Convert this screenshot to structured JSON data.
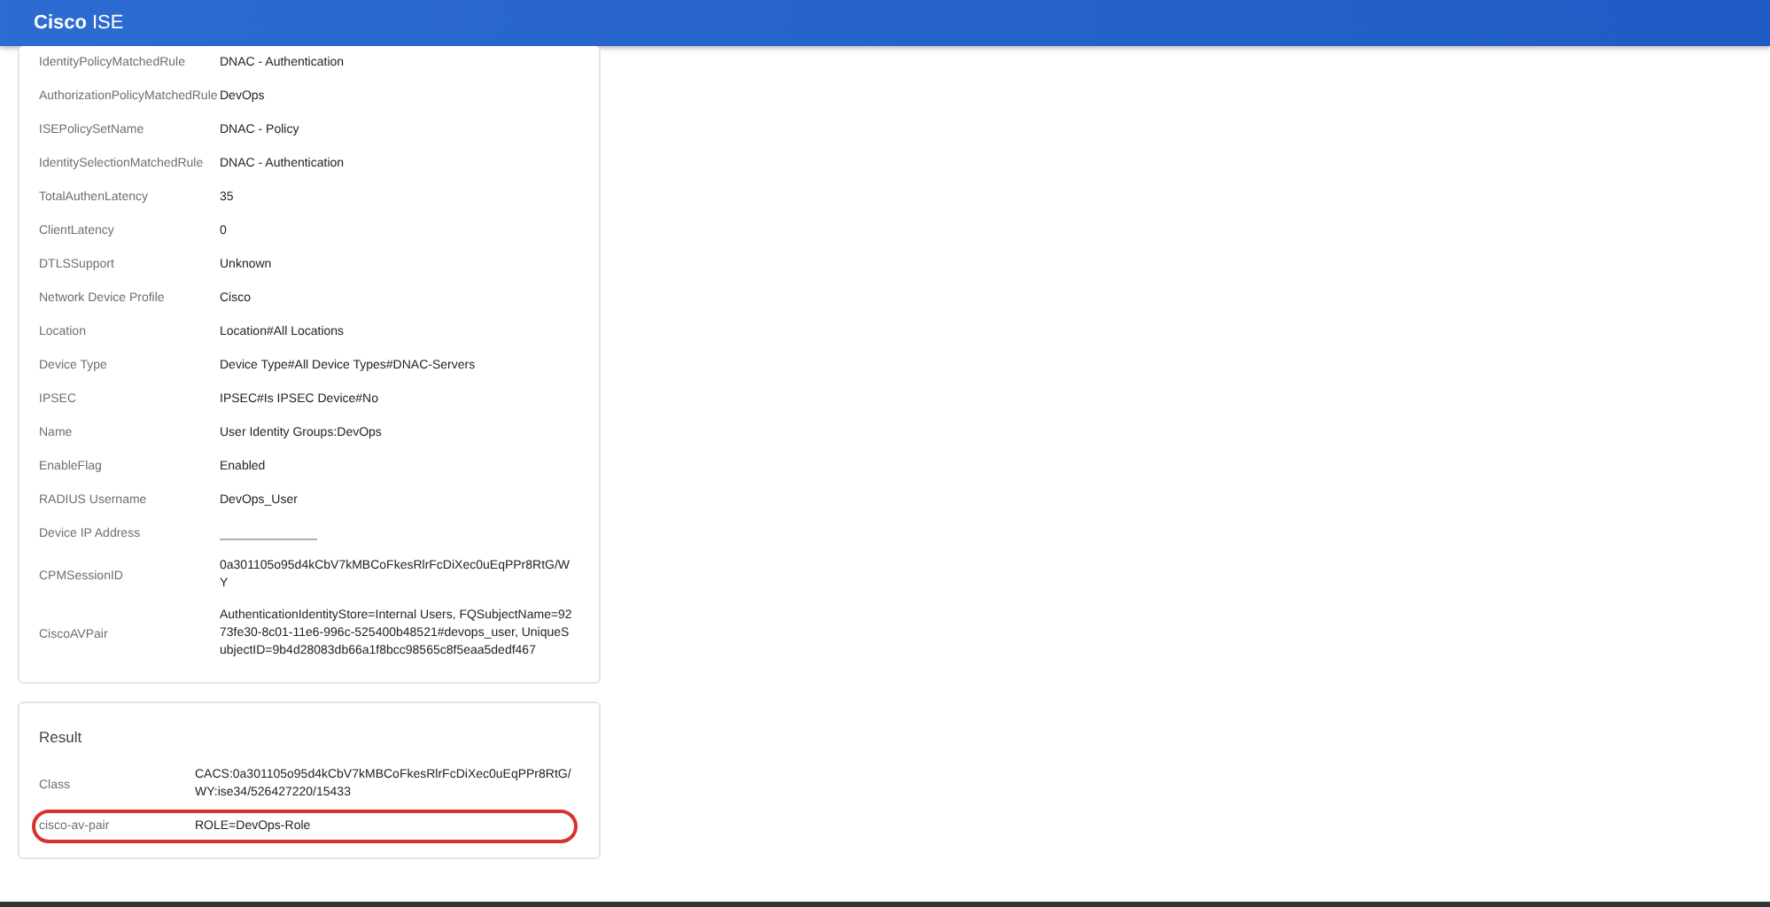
{
  "header": {
    "brand": "Cisco",
    "product": "ISE"
  },
  "details": {
    "rows": [
      {
        "label": "IdentityPolicyMatchedRule",
        "value": "DNAC - Authentication"
      },
      {
        "label": "AuthorizationPolicyMatchedRule",
        "value": "DevOps"
      },
      {
        "label": "ISEPolicySetName",
        "value": "DNAC - Policy"
      },
      {
        "label": "IdentitySelectionMatchedRule",
        "value": "DNAC - Authentication"
      },
      {
        "label": "TotalAuthenLatency",
        "value": "35"
      },
      {
        "label": "ClientLatency",
        "value": "0"
      },
      {
        "label": "DTLSSupport",
        "value": "Unknown"
      },
      {
        "label": "Network Device Profile",
        "value": "Cisco"
      },
      {
        "label": "Location",
        "value": "Location#All Locations"
      },
      {
        "label": "Device Type",
        "value": "Device Type#All Device Types#DNAC-Servers"
      },
      {
        "label": "IPSEC",
        "value": "IPSEC#Is IPSEC Device#No"
      },
      {
        "label": "Name",
        "value": "User Identity Groups:DevOps"
      },
      {
        "label": "EnableFlag",
        "value": "Enabled"
      },
      {
        "label": "RADIUS Username",
        "value": "DevOps_User"
      },
      {
        "label": "Device IP Address",
        "redacted": true
      },
      {
        "label": "CPMSessionID",
        "value": "0a301105o95d4kCbV7kMBCoFkesRlrFcDiXec0uEqPPr8RtG/WY"
      },
      {
        "label": "CiscoAVPair",
        "value": "AuthenticationIdentityStore=Internal Users, FQSubjectName=9273fe30-8c01-11e6-996c-525400b48521#devops_user, UniqueSubjectID=9b4d28083db66a1f8bcc98565c8f5eaa5dedf467"
      }
    ]
  },
  "result": {
    "title": "Result",
    "rows": [
      {
        "label": "Class",
        "value": "CACS:0a301105o95d4kCbV7kMBCoFkesRlrFcDiXec0uEqPPr8RtG/WY:ise34/526427220/15433",
        "highlighted": false
      },
      {
        "label": "cisco-av-pair",
        "value": "ROLE=DevOps-Role",
        "highlighted": true
      }
    ]
  }
}
